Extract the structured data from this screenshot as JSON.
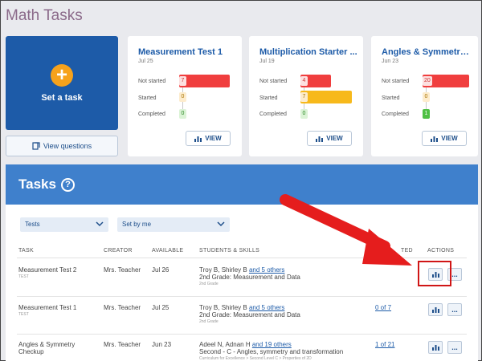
{
  "app_title": "Math Tasks",
  "set_task": {
    "label": "Set a task"
  },
  "view_questions": {
    "label": "View questions"
  },
  "stat_labels": {
    "not_started": "Not started",
    "started": "Started",
    "completed": "Completed"
  },
  "cards": [
    {
      "title": "Measurement Test 1",
      "date": "Jul 25",
      "not_started": 7,
      "started": 0,
      "completed": 0,
      "view": "VIEW"
    },
    {
      "title": "Multiplication Starter ...",
      "date": "Jul 19",
      "not_started": 4,
      "started": 7,
      "completed": 0,
      "view": "VIEW"
    },
    {
      "title": "Angles & Symmetry C...",
      "date": "Jun 23",
      "not_started": 20,
      "started": 0,
      "completed": 1,
      "view": "VIEW"
    }
  ],
  "colors": {
    "not_started": "#f03e3e",
    "started": "#f7b91b",
    "completed": "#4fc045",
    "primary": "#1d5ba8"
  },
  "tasks": {
    "title": "Tasks",
    "filters": [
      {
        "value": "Tests"
      },
      {
        "value": "Set by me"
      }
    ],
    "columns": {
      "task": "TASK",
      "creator": "CREATOR",
      "available": "AVAILABLE",
      "students": "STUDENTS & SKILLS",
      "completed": "TED",
      "actions": "ACTIONS"
    },
    "rows": [
      {
        "task": "Measurement Test 2",
        "tag": "TEST",
        "creator": "Mrs. Teacher",
        "available": "Jul 26",
        "students": "Troy B, Shirley B",
        "others": "and 5 others",
        "skill": "2nd Grade: Measurement and Data",
        "skill_sub": "2nd Grade",
        "completed": ""
      },
      {
        "task": "Measurement Test 1",
        "tag": "TEST",
        "creator": "Mrs. Teacher",
        "available": "Jul 25",
        "students": "Troy B, Shirley B",
        "others": "and 5 others",
        "skill": "2nd Grade: Measurement and Data",
        "skill_sub": "2nd Grade",
        "completed": "0 of 7"
      },
      {
        "task": "Angles & Symmetry Checkup",
        "tag": "",
        "creator": "Mrs. Teacher",
        "available": "Jun 23",
        "students": "Adeel N, Adnan H",
        "others": "and 19 others",
        "skill": "Second - C - Angles, symmetry and transformation",
        "skill_sub": "Curriculum for Excellence > Second Level C > Properties of 2D",
        "completed": "1 of 21"
      }
    ],
    "more_icon": "..."
  }
}
